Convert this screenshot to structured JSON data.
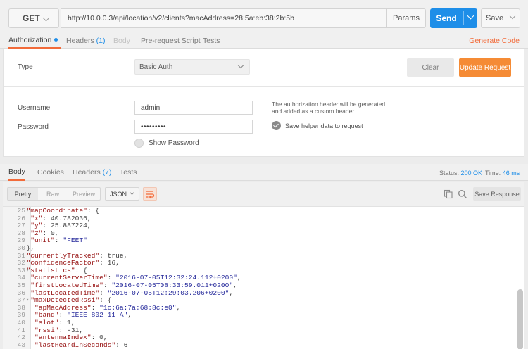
{
  "request": {
    "method": "GET",
    "url": "http://10.0.0.3/api/location/v2/clients?macAddress=28:5a:eb:38:2b:5b",
    "params_label": "Params",
    "send_label": "Send",
    "save_label": "Save"
  },
  "request_tabs": {
    "authorization": "Authorization",
    "headers": "Headers",
    "headers_count": "(1)",
    "body": "Body",
    "pre_request": "Pre-request Script",
    "tests": "Tests",
    "generate_code": "Generate Code"
  },
  "auth": {
    "type_label": "Type",
    "type_value": "Basic Auth",
    "clear_label": "Clear",
    "update_label": "Update Request",
    "username_label": "Username",
    "username_value": "admin",
    "password_label": "Password",
    "password_value": "•••••••••",
    "show_password_label": "Show Password",
    "info_text": "The authorization header will be generated and added as a custom header",
    "save_helper_label": "Save helper data to request"
  },
  "response_tabs": {
    "body": "Body",
    "cookies": "Cookies",
    "headers": "Headers",
    "headers_count": "(7)",
    "tests": "Tests",
    "status_label": "Status:",
    "status_value": "200 OK",
    "time_label": "Time:",
    "time_value": "46 ms"
  },
  "body_toolbar": {
    "pretty": "Pretty",
    "raw": "Raw",
    "preview": "Preview",
    "format": "JSON",
    "save_response": "Save Response"
  },
  "code_lines": [
    {
      "n": "25",
      "fold": true,
      "i": 2,
      "parts": [
        [
          "k",
          "\"mapCoordinate\""
        ],
        [
          "n",
          ": {"
        ]
      ]
    },
    {
      "n": "26",
      "fold": false,
      "i": 3,
      "parts": [
        [
          "k",
          "\"x\""
        ],
        [
          "n",
          ": 40.782036,"
        ]
      ]
    },
    {
      "n": "27",
      "fold": false,
      "i": 3,
      "parts": [
        [
          "k",
          "\"y\""
        ],
        [
          "n",
          ": 25.887224,"
        ]
      ]
    },
    {
      "n": "28",
      "fold": false,
      "i": 3,
      "parts": [
        [
          "k",
          "\"z\""
        ],
        [
          "n",
          ": 0,"
        ]
      ]
    },
    {
      "n": "29",
      "fold": false,
      "i": 3,
      "parts": [
        [
          "k",
          "\"unit\""
        ],
        [
          "n",
          ": "
        ],
        [
          "s",
          "\"FEET\""
        ]
      ]
    },
    {
      "n": "30",
      "fold": false,
      "i": 2,
      "parts": [
        [
          "n",
          "},"
        ]
      ]
    },
    {
      "n": "31",
      "fold": false,
      "i": 2,
      "parts": [
        [
          "k",
          "\"currentlyTracked\""
        ],
        [
          "n",
          ": true,"
        ]
      ]
    },
    {
      "n": "32",
      "fold": false,
      "i": 2,
      "parts": [
        [
          "k",
          "\"confidenceFactor\""
        ],
        [
          "n",
          ": 16,"
        ]
      ]
    },
    {
      "n": "33",
      "fold": true,
      "i": 2,
      "parts": [
        [
          "k",
          "\"statistics\""
        ],
        [
          "n",
          ": {"
        ]
      ]
    },
    {
      "n": "34",
      "fold": false,
      "i": 3,
      "parts": [
        [
          "k",
          "\"currentServerTime\""
        ],
        [
          "n",
          ": "
        ],
        [
          "s",
          "\"2016-07-05T12:32:24.112+0200\""
        ],
        [
          "n",
          ","
        ]
      ]
    },
    {
      "n": "35",
      "fold": false,
      "i": 3,
      "parts": [
        [
          "k",
          "\"firstLocatedTime\""
        ],
        [
          "n",
          ": "
        ],
        [
          "s",
          "\"2016-07-05T08:33:59.011+0200\""
        ],
        [
          "n",
          ","
        ]
      ]
    },
    {
      "n": "36",
      "fold": false,
      "i": 3,
      "parts": [
        [
          "k",
          "\"lastLocatedTime\""
        ],
        [
          "n",
          ": "
        ],
        [
          "s",
          "\"2016-07-05T12:29:03.206+0200\""
        ],
        [
          "n",
          ","
        ]
      ]
    },
    {
      "n": "37",
      "fold": true,
      "i": 3,
      "parts": [
        [
          "k",
          "\"maxDetectedRssi\""
        ],
        [
          "n",
          ": {"
        ]
      ]
    },
    {
      "n": "38",
      "fold": false,
      "i": 4,
      "parts": [
        [
          "k",
          "\"apMacAddress\""
        ],
        [
          "n",
          ": "
        ],
        [
          "s",
          "\"1c:6a:7a:68:8c:e0\""
        ],
        [
          "n",
          ","
        ]
      ]
    },
    {
      "n": "39",
      "fold": false,
      "i": 4,
      "parts": [
        [
          "k",
          "\"band\""
        ],
        [
          "n",
          ": "
        ],
        [
          "s",
          "\"IEEE_802_11_A\""
        ],
        [
          "n",
          ","
        ]
      ]
    },
    {
      "n": "40",
      "fold": false,
      "i": 4,
      "parts": [
        [
          "k",
          "\"slot\""
        ],
        [
          "n",
          ": 1,"
        ]
      ]
    },
    {
      "n": "41",
      "fold": false,
      "i": 4,
      "parts": [
        [
          "k",
          "\"rssi\""
        ],
        [
          "n",
          ": -31,"
        ]
      ]
    },
    {
      "n": "42",
      "fold": false,
      "i": 4,
      "parts": [
        [
          "k",
          "\"antennaIndex\""
        ],
        [
          "n",
          ": 0,"
        ]
      ]
    },
    {
      "n": "43",
      "fold": false,
      "i": 4,
      "parts": [
        [
          "k",
          "\"lastHeardInSeconds\""
        ],
        [
          "n",
          ": 6"
        ]
      ]
    }
  ],
  "colors": {
    "accent_blue": "#1e8ee8",
    "accent_orange": "#f26b3a",
    "update_orange": "#f58b35",
    "json_key": "#961010",
    "json_string": "#262a9b"
  },
  "icons": [
    "chevron-down-icon",
    "copy-icon",
    "search-icon",
    "wrap-lines-icon",
    "checkmark-icon"
  ]
}
